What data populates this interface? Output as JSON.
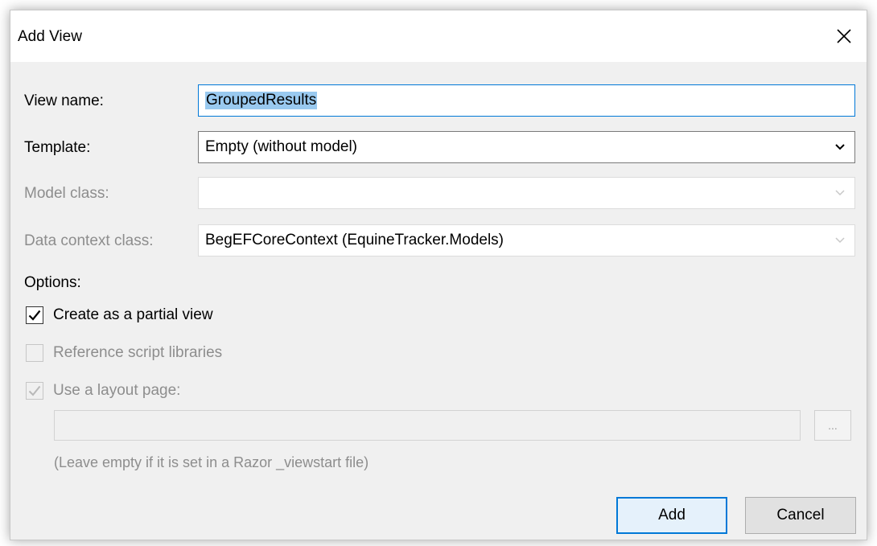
{
  "window": {
    "title": "Add View"
  },
  "form": {
    "view_name_label": "View name:",
    "view_name_value": "GroupedResults",
    "template_label": "Template:",
    "template_value": "Empty (without model)",
    "model_class_label": "Model class:",
    "model_class_value": "",
    "data_context_label": "Data context class:",
    "data_context_value": "BegEFCoreContext (EquineTracker.Models)"
  },
  "options": {
    "heading": "Options:",
    "partial_view_label": "Create as a partial view",
    "partial_view_checked": true,
    "reference_scripts_label": "Reference script libraries",
    "reference_scripts_checked": false,
    "layout_page_label": "Use a layout page:",
    "layout_page_checked": true,
    "layout_page_value": "",
    "browse_label": "...",
    "layout_hint": "(Leave empty if it is set in a Razor _viewstart file)"
  },
  "buttons": {
    "add_label": "Add",
    "cancel_label": "Cancel"
  },
  "colors": {
    "accent": "#0078d7",
    "selection": "#99c9ef",
    "disabled_text": "#8d8d8d",
    "dialog_bg": "#f0f0f0"
  }
}
